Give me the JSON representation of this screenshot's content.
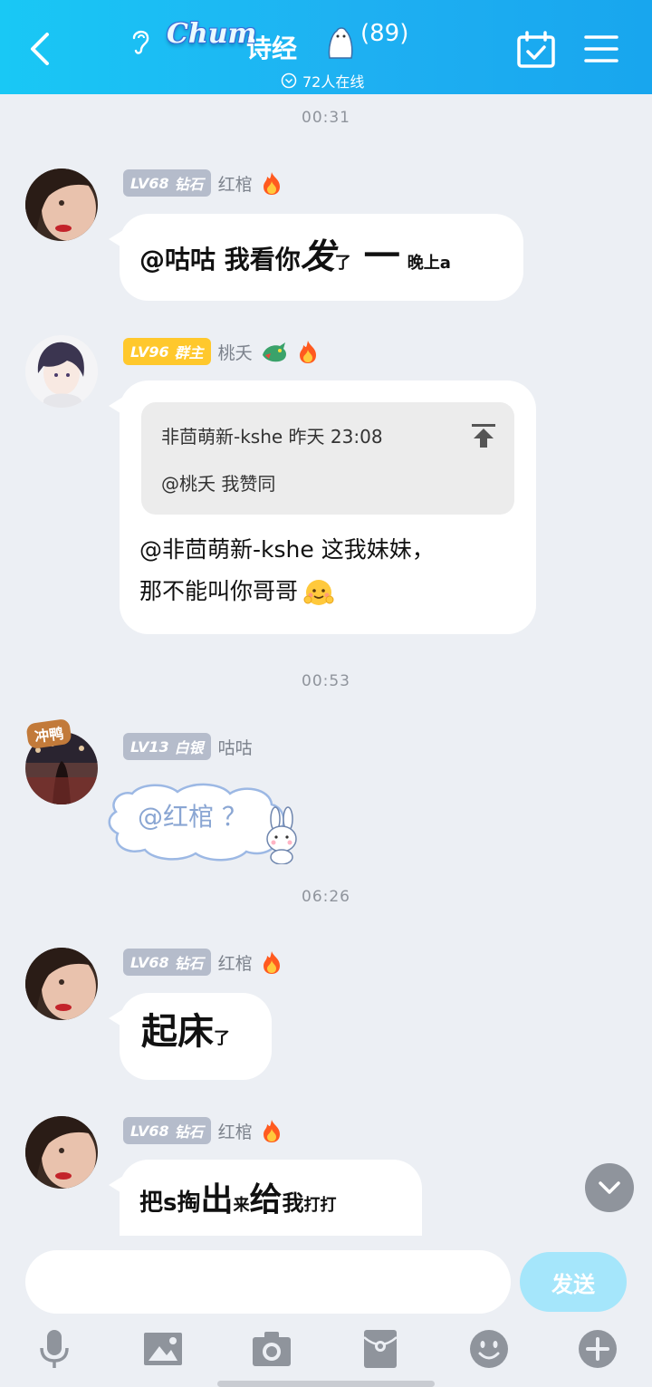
{
  "header": {
    "logo_text": "Chum",
    "group_name": "诗经",
    "member_count": "(89)",
    "online_text": "72人在线"
  },
  "messages": [
    {
      "timestamp": "00:31",
      "level": "LV68",
      "title": "钻石",
      "sender": "红棺",
      "text_parts": [
        "@咕咕 我看你",
        "发",
        "了",
        "一",
        "晚上a"
      ]
    },
    {
      "level": "LV96",
      "title": "群主",
      "sender": "桃夭",
      "quote_header": "非茴萌新-kshe 昨天 23:08",
      "quote_body": "@桃夭 我赞同",
      "text_line1": "@非茴萌新-kshe 这我妹妹，",
      "text_line2": "那不能叫你哥哥"
    },
    {
      "timestamp": "00:53",
      "level": "LV13",
      "title": "白银",
      "sender": "咕咕",
      "avatar_sticker": "冲鸭",
      "text": "@红棺 ？"
    },
    {
      "timestamp": "06:26",
      "level": "LV68",
      "title": "钻石",
      "sender": "红棺",
      "text_parts": [
        "起床",
        "了"
      ]
    },
    {
      "level": "LV68",
      "title": "钻石",
      "sender": "红棺",
      "text_parts": [
        "把s掏",
        "出",
        "来",
        "给",
        "我",
        "打打"
      ]
    }
  ],
  "composer": {
    "input_value": "",
    "send_label": "发送"
  },
  "colors": {
    "header_start": "#19c8f5",
    "header_end": "#18a6ee",
    "background": "#eceff4",
    "badge_gray": "#b5bccb",
    "badge_gold": "#ffc82c",
    "send_button": "#a5e6fb"
  },
  "icons": [
    "back-icon",
    "ear-icon",
    "mascot-icon",
    "calendar-check-icon",
    "menu-icon",
    "fire-icon",
    "dragon-icon",
    "pin-top-icon",
    "emoji-icon",
    "bunny-icon",
    "chevron-down-icon",
    "mic-icon",
    "image-icon",
    "camera-icon",
    "red-packet-icon",
    "smile-icon",
    "plus-icon"
  ]
}
